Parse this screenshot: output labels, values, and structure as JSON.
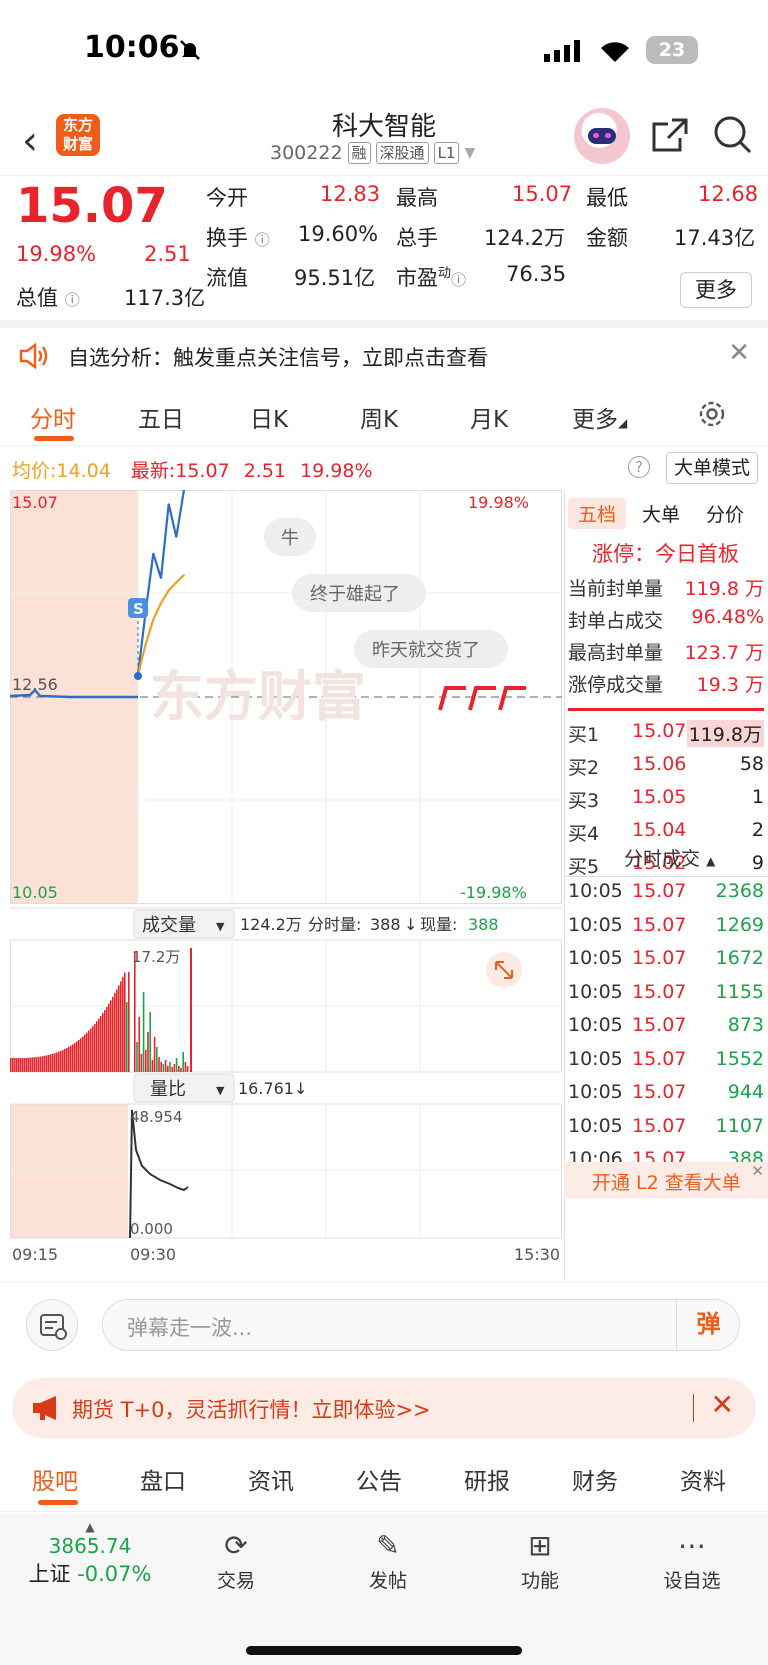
{
  "status_bar": {
    "time": "10:06",
    "battery": "23"
  },
  "header": {
    "logo_text": "东方财富",
    "stock_name": "科大智能",
    "stock_code": "300222",
    "tags": [
      "融",
      "深股通",
      "L1"
    ]
  },
  "quote": {
    "price": "15.07",
    "change_pct": "19.98%",
    "change": "2.51",
    "fields": {
      "open_label": "今开",
      "open": "12.83",
      "high_label": "最高",
      "high": "15.07",
      "low_label": "最低",
      "low": "12.68",
      "turnover_label": "换手",
      "turnover": "19.60%",
      "volume_label": "总手",
      "volume": "124.2万",
      "amount_label": "金额",
      "amount": "17.43亿",
      "mktcap_label": "总值",
      "mktcap": "117.3亿",
      "float_label": "流值",
      "float": "95.51亿",
      "pe_label": "市盈",
      "pe_sup": "动",
      "pe": "76.35"
    },
    "more_label": "更多"
  },
  "alert": {
    "text": "自选分析：触发重点关注信号，立即点击查看"
  },
  "chart_tabs": [
    "分时",
    "五日",
    "日K",
    "周K",
    "月K",
    "更多"
  ],
  "avg_row": {
    "avg_label": "均价:",
    "avg": "14.04",
    "latest_label": "最新:",
    "latest": "15.07",
    "change": "2.51",
    "pct": "19.98%",
    "mode_label": "大单模式"
  },
  "chart": {
    "y_top": "15.07",
    "y_mid": "12.56",
    "y_bottom": "10.05",
    "pct_top": "19.98%",
    "pct_bottom": "-19.98%",
    "danmu": [
      "牛",
      "终于雄起了",
      "昨天就交货了"
    ],
    "volume_header": {
      "label": "成交量",
      "total": "124.2万",
      "fenshi_label": "分时量:",
      "fenshi": "388",
      "xian_label": "现量:",
      "xian": "388",
      "max": "17.2万"
    },
    "ratio_header": {
      "label": "量比",
      "value": "16.761",
      "max": "48.954",
      "min": "0.000"
    },
    "x_labels": [
      "09:15",
      "09:30",
      "15:30"
    ],
    "marker": "S"
  },
  "chart_data": {
    "type": "line",
    "x": [
      "09:30",
      "09:31",
      "09:32",
      "09:33",
      "09:34",
      "09:35",
      "09:36"
    ],
    "series": [
      {
        "name": "最新",
        "values": [
          12.83,
          13.6,
          14.3,
          14.0,
          14.9,
          14.5,
          15.07
        ]
      },
      {
        "name": "均价",
        "values": [
          12.83,
          13.2,
          13.5,
          13.7,
          13.85,
          13.95,
          14.04
        ]
      }
    ],
    "ylim": [
      10.05,
      15.07
    ]
  },
  "panel": {
    "tabs": [
      "五档",
      "大单",
      "分价"
    ],
    "limit_label": "涨停：今日首板",
    "stats": [
      {
        "label": "当前封单量",
        "value": "119.8 万"
      },
      {
        "label": "封单占成交",
        "value": "96.48%"
      },
      {
        "label": "最高封单量",
        "value": "123.7 万"
      },
      {
        "label": "涨停成交量",
        "value": "19.3 万"
      }
    ],
    "bids": [
      {
        "label": "买1",
        "price": "15.07",
        "vol": "119.8万"
      },
      {
        "label": "买2",
        "price": "15.06",
        "vol": "58"
      },
      {
        "label": "买3",
        "price": "15.05",
        "vol": "1"
      },
      {
        "label": "买4",
        "price": "15.04",
        "vol": "2"
      },
      {
        "label": "买5",
        "price": "15.02",
        "vol": "9"
      }
    ],
    "ticks_label": "分时成交",
    "ticks": [
      {
        "time": "10:05",
        "price": "15.07",
        "vol": "2368"
      },
      {
        "time": "10:05",
        "price": "15.07",
        "vol": "1269"
      },
      {
        "time": "10:05",
        "price": "15.07",
        "vol": "1672"
      },
      {
        "time": "10:05",
        "price": "15.07",
        "vol": "1155"
      },
      {
        "time": "10:05",
        "price": "15.07",
        "vol": "873"
      },
      {
        "time": "10:05",
        "price": "15.07",
        "vol": "1552"
      },
      {
        "time": "10:05",
        "price": "15.07",
        "vol": "944"
      },
      {
        "time": "10:05",
        "price": "15.07",
        "vol": "1107"
      },
      {
        "time": "10:06",
        "price": "15.07",
        "vol": "388"
      }
    ],
    "l2_label": "开通 L2 查看大单"
  },
  "danmu_input": {
    "placeholder": "弹幕走一波...",
    "button": "弹"
  },
  "promo": {
    "text": "期货 T+0，灵活抓行情！立即体验>>"
  },
  "bottom_tabs": [
    "股吧",
    "盘口",
    "资讯",
    "公告",
    "研报",
    "财务",
    "资料"
  ],
  "toolbar": {
    "index_value": "3865.74",
    "index_name": "上证",
    "index_pct": "-0.07%",
    "items": [
      "交易",
      "发帖",
      "功能",
      "设自选"
    ]
  }
}
